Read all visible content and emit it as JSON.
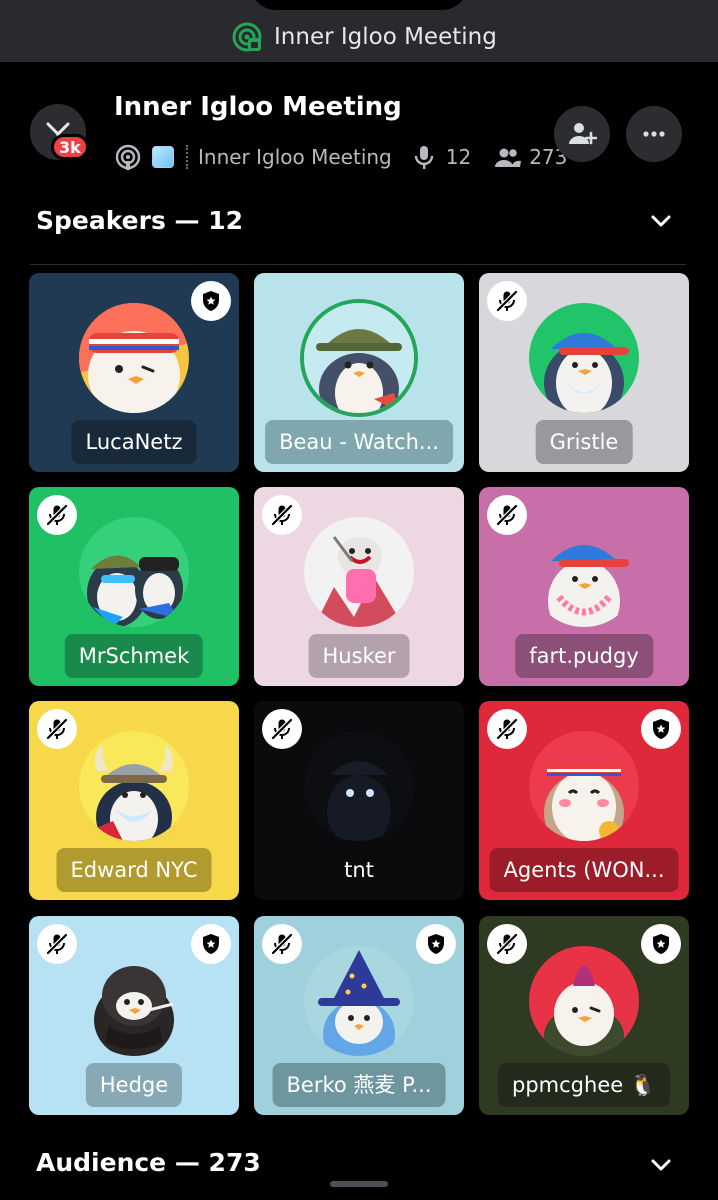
{
  "status_bar": {
    "title": "Inner Igloo Meeting",
    "icon": "stage-channel-icon"
  },
  "header": {
    "event_title": "Inner Igloo Meeting",
    "channel_name": "Inner Igloo Meeting",
    "speaker_count": "12",
    "listener_count": "273",
    "server_badge": "3k",
    "icons": [
      "stage-icon",
      "ice-cube-emoji",
      "microphone-icon",
      "people-icon",
      "add-user-icon",
      "more-icon"
    ]
  },
  "speakers": {
    "heading": "Speakers — 12",
    "tiles": [
      {
        "name": "LucaNetz",
        "bg": "#1f3a52",
        "muted": false,
        "moderator": true
      },
      {
        "name": "Beau - Watch...",
        "bg": "#b9e3ea",
        "muted": false,
        "moderator": false,
        "speaking": true
      },
      {
        "name": "Gristle",
        "bg": "#d8d8dc",
        "muted": true,
        "moderator": false
      },
      {
        "name": "MrSchmek",
        "bg": "#20c065",
        "muted": true,
        "moderator": false
      },
      {
        "name": "Husker",
        "bg": "#ecd7e3",
        "muted": true,
        "moderator": false
      },
      {
        "name": "fart.pudgy",
        "bg": "#c86ea9",
        "muted": true,
        "moderator": false
      },
      {
        "name": "Edward NYC",
        "bg": "#f6d84a",
        "muted": true,
        "moderator": false
      },
      {
        "name": "tnt",
        "bg": "#0b0b0d",
        "muted": true,
        "moderator": false
      },
      {
        "name": "Agents (WON...",
        "bg": "#e0283b",
        "muted": true,
        "moderator": true
      },
      {
        "name": "Hedge",
        "bg": "#b7e2f3",
        "muted": true,
        "moderator": true
      },
      {
        "name": "Berko 燕麦 P...",
        "bg": "#9fd1dc",
        "muted": true,
        "moderator": true
      },
      {
        "name": "ppmcghee 🐧",
        "bg": "#2f3a23",
        "muted": true,
        "moderator": true
      }
    ]
  },
  "audience": {
    "heading": "Audience — 273"
  }
}
